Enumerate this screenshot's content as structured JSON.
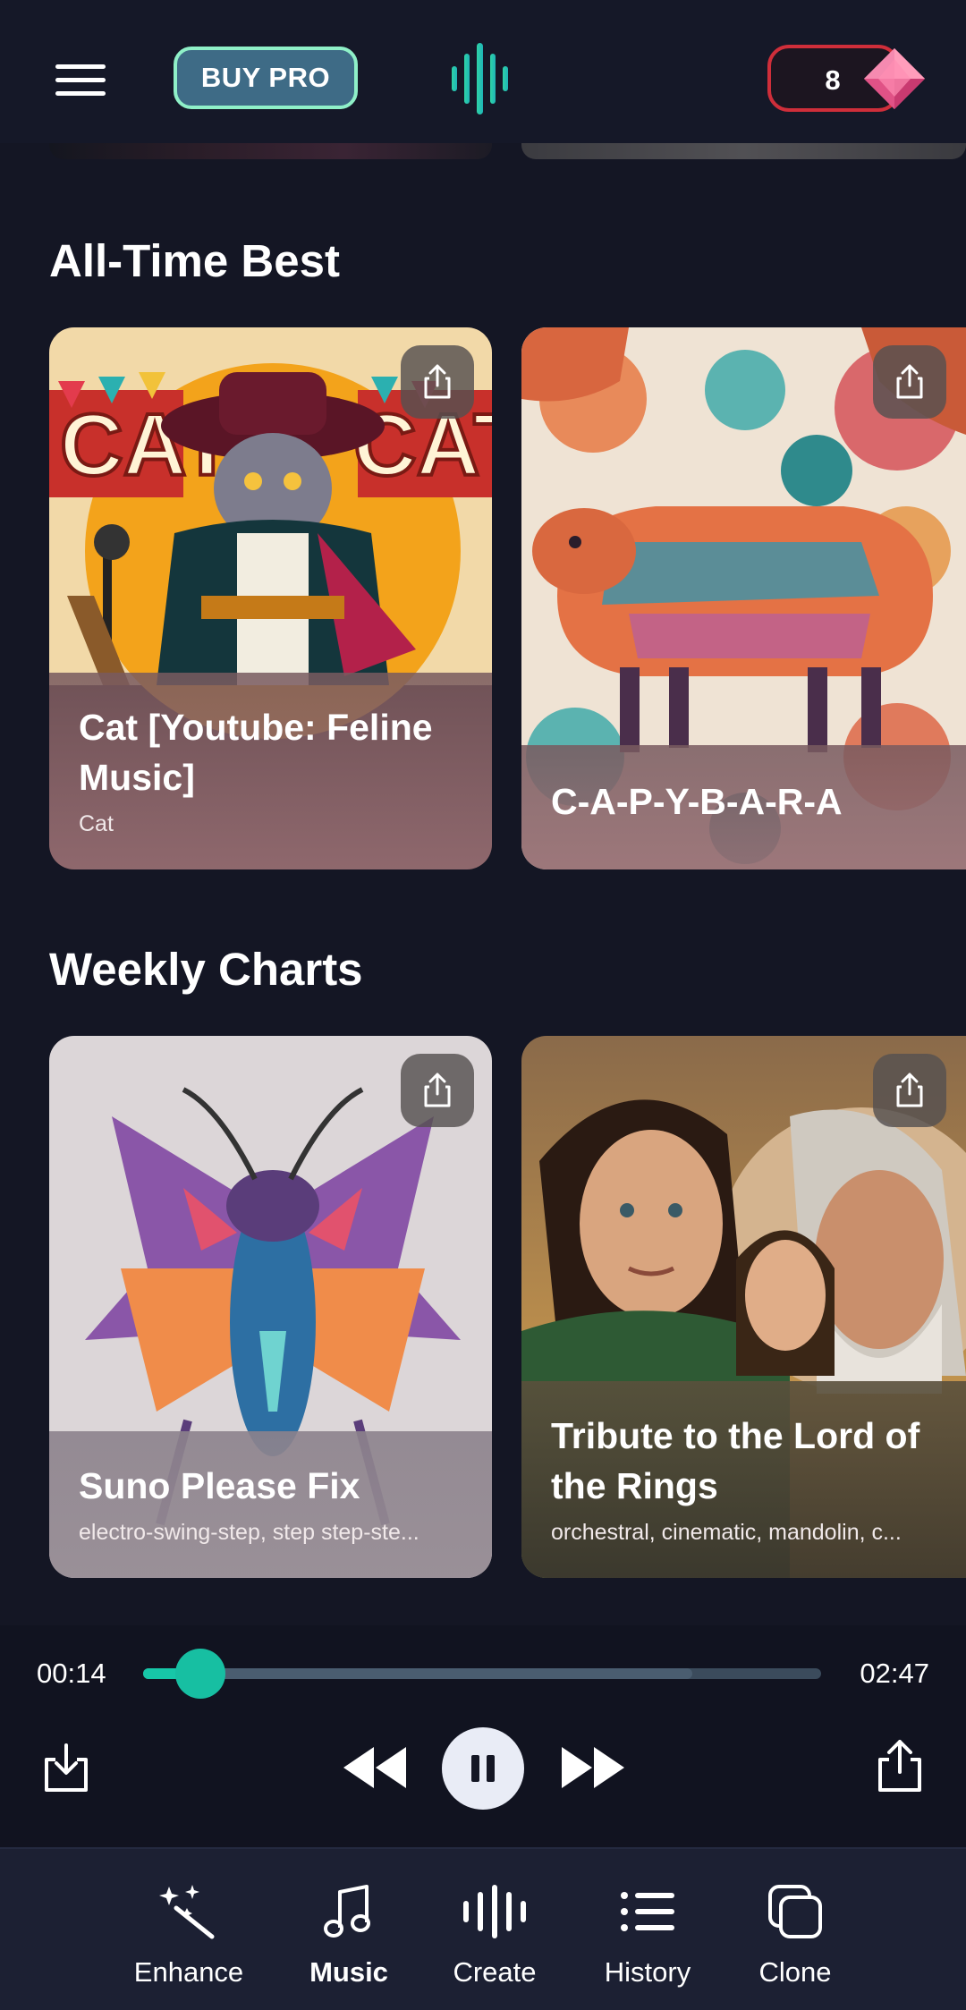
{
  "header": {
    "buy_pro_label": "BUY PRO",
    "gem_count": "8",
    "accent_color": "#17c7a8"
  },
  "sections": [
    {
      "title": "All-Time Best",
      "cards": [
        {
          "title": "Cat [Youtube: Feline Music]",
          "subtitle": "Cat",
          "art": "cartoon-cat-singer-illustration"
        },
        {
          "title": "C-A-P-Y-B-A-R-A",
          "subtitle": "",
          "art": "patterned-capybara-illustration"
        }
      ]
    },
    {
      "title": "Weekly Charts",
      "cards": [
        {
          "title": "Suno Please Fix",
          "subtitle": "electro-swing-step, step step-ste...",
          "art": "geometric-insect-illustration"
        },
        {
          "title": "Tribute to the Lord of the Rings",
          "subtitle": "orchestral, cinematic, mandolin, c...",
          "art": "fantasy-characters-illustration"
        }
      ]
    }
  ],
  "player": {
    "elapsed": "00:14",
    "duration": "02:47",
    "progress_fraction": 0.084,
    "buffered_fraction": 0.81
  },
  "nav": {
    "items": [
      {
        "label": "Enhance",
        "icon": "magic-wand-icon",
        "active": false
      },
      {
        "label": "Music",
        "icon": "music-note-icon",
        "active": true
      },
      {
        "label": "Create",
        "icon": "waveform-icon",
        "active": false
      },
      {
        "label": "History",
        "icon": "list-icon",
        "active": false
      },
      {
        "label": "Clone",
        "icon": "clone-icon",
        "active": false
      }
    ]
  }
}
